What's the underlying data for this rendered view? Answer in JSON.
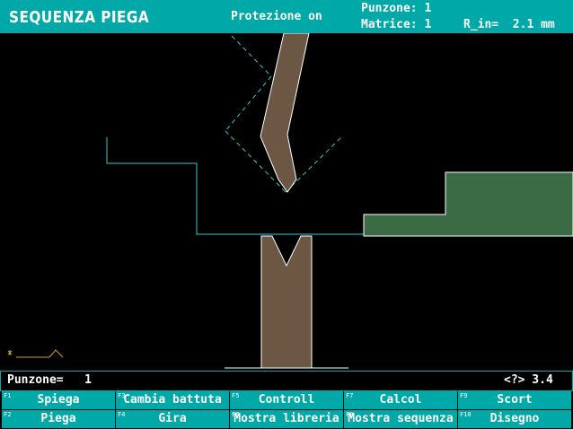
{
  "header": {
    "title": "SEQUENZA PIEGA",
    "protection": "Protezione on",
    "punch_label": "Punzone: 1",
    "die_label": "Matrice: 1",
    "radius_label": "R_in=  2.1 mm"
  },
  "status_bar": {
    "punch_text": "Punzone=   1",
    "help_text": "<?> 3.4"
  },
  "function_keys": [
    {
      "key": "F1",
      "label": "Spiega"
    },
    {
      "key": "F3",
      "label": "Cambia battuta"
    },
    {
      "key": "F5",
      "label": "Controll"
    },
    {
      "key": "F7",
      "label": "Calcol"
    },
    {
      "key": "F9",
      "label": "Scort"
    },
    {
      "key": "F2",
      "label": "Piega"
    },
    {
      "key": "F4",
      "label": "Gira"
    },
    {
      "key": "F6",
      "label": "Mostra libreria"
    },
    {
      "key": "F8",
      "label": "Mostra sequenza"
    },
    {
      "key": "F10",
      "label": "Disegno"
    }
  ],
  "colors": {
    "header_bg": "#00a8a8",
    "tool_fill": "#6b5744",
    "part_fill": "#3b6b45",
    "outline_cyan": "#33cccc",
    "mini_preview": "#d4a017"
  }
}
